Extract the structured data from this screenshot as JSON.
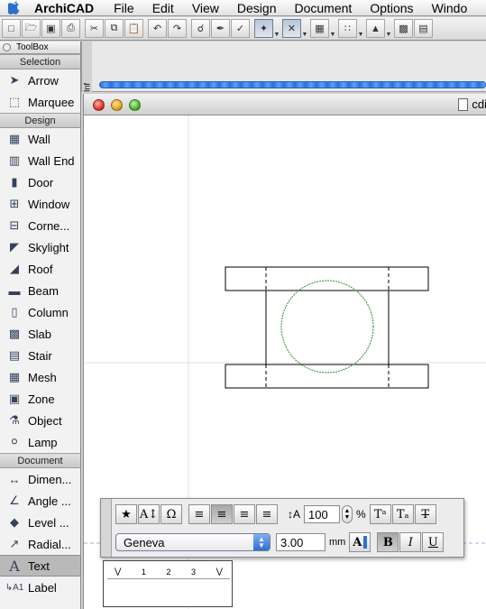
{
  "menubar": {
    "apple_icon": "apple-icon",
    "app_name": "ArchiCAD",
    "items": [
      "File",
      "Edit",
      "View",
      "Design",
      "Document",
      "Options",
      "Windo"
    ]
  },
  "toolbar": {
    "buttons": [
      "new-icon",
      "open-icon",
      "save-icon",
      "print-icon",
      "cut-icon",
      "copy-icon",
      "paste-icon",
      "undo-icon",
      "redo-icon",
      "find-icon",
      "eyedropper-icon",
      "syringe-icon",
      "magic-wand-icon",
      "snap-icon",
      "grid-icon",
      "layer-icon",
      "story-icon",
      "display-icon"
    ]
  },
  "infobox": {
    "tab_label": "Inf"
  },
  "toolbox": {
    "title": "ToolBox",
    "sections": [
      {
        "label": "Selection",
        "tools": [
          {
            "label": "Arrow",
            "icon": "arrow-icon"
          },
          {
            "label": "Marquee",
            "icon": "marquee-icon"
          }
        ]
      },
      {
        "label": "Design",
        "tools": [
          {
            "label": "Wall",
            "icon": "wall-icon"
          },
          {
            "label": "Wall End",
            "icon": "wall-end-icon"
          },
          {
            "label": "Door",
            "icon": "door-icon"
          },
          {
            "label": "Window",
            "icon": "window-icon"
          },
          {
            "label": "Corne...",
            "icon": "corner-window-icon"
          },
          {
            "label": "Skylight",
            "icon": "skylight-icon"
          },
          {
            "label": "Roof",
            "icon": "roof-icon"
          },
          {
            "label": "Beam",
            "icon": "beam-icon"
          },
          {
            "label": "Column",
            "icon": "column-icon"
          },
          {
            "label": "Slab",
            "icon": "slab-icon"
          },
          {
            "label": "Stair",
            "icon": "stair-icon"
          },
          {
            "label": "Mesh",
            "icon": "mesh-icon"
          },
          {
            "label": "Zone",
            "icon": "zone-icon"
          },
          {
            "label": "Object",
            "icon": "object-icon"
          },
          {
            "label": "Lamp",
            "icon": "lamp-icon"
          }
        ]
      },
      {
        "label": "Document",
        "tools": [
          {
            "label": "Dimen...",
            "icon": "dimension-icon"
          },
          {
            "label": "Angle ...",
            "icon": "angle-dimension-icon"
          },
          {
            "label": "Level ...",
            "icon": "level-dimension-icon"
          },
          {
            "label": "Radial...",
            "icon": "radial-dimension-icon"
          },
          {
            "label": "Text",
            "icon": "text-icon",
            "selected": true
          },
          {
            "label": "Label",
            "icon": "label-icon"
          }
        ]
      }
    ]
  },
  "document_window": {
    "title": "cdi",
    "icon": "document-icon"
  },
  "text_palette": {
    "size_value": "100",
    "size_unit": "%",
    "font_name": "Geneva",
    "font_height": "3.00",
    "height_unit": "mm",
    "style_buttons": {
      "bold": "B",
      "italic": "I",
      "underline": "U"
    }
  },
  "ruler": {
    "ticks": [
      "1",
      "2",
      "3"
    ]
  },
  "colors": {
    "circle": "#2e8b3e",
    "selection_blue": "#2a6fe0"
  }
}
